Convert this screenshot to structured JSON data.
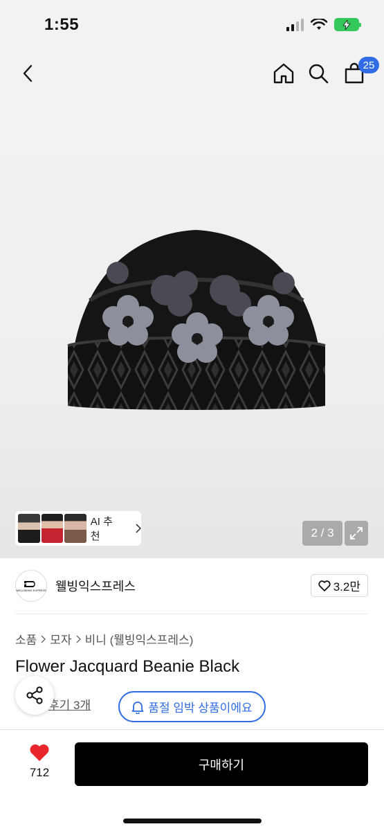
{
  "status_bar": {
    "time": "1:55"
  },
  "nav": {
    "cart_count": "25"
  },
  "hero": {
    "ai_label": "AI 추천",
    "counter": "2 / 3"
  },
  "brand": {
    "logo_text": "WELLBEING EXPRESS",
    "name": "웰빙익스프레스",
    "likes": "3.2만"
  },
  "breadcrumb": {
    "items": [
      "소품",
      "모자",
      "비니 (웰빙익스프레스)"
    ]
  },
  "product": {
    "title": "Flower Jacquard Beanie Black",
    "review_link": "후기 3개",
    "soldout_notice": "품절 임박 상품이에요"
  },
  "bottom": {
    "wish_count": "712",
    "buy_label": "구매하기"
  },
  "colors": {
    "accent": "#2f6ce5",
    "heart": "#e8262b",
    "buy_bg": "#000000"
  }
}
